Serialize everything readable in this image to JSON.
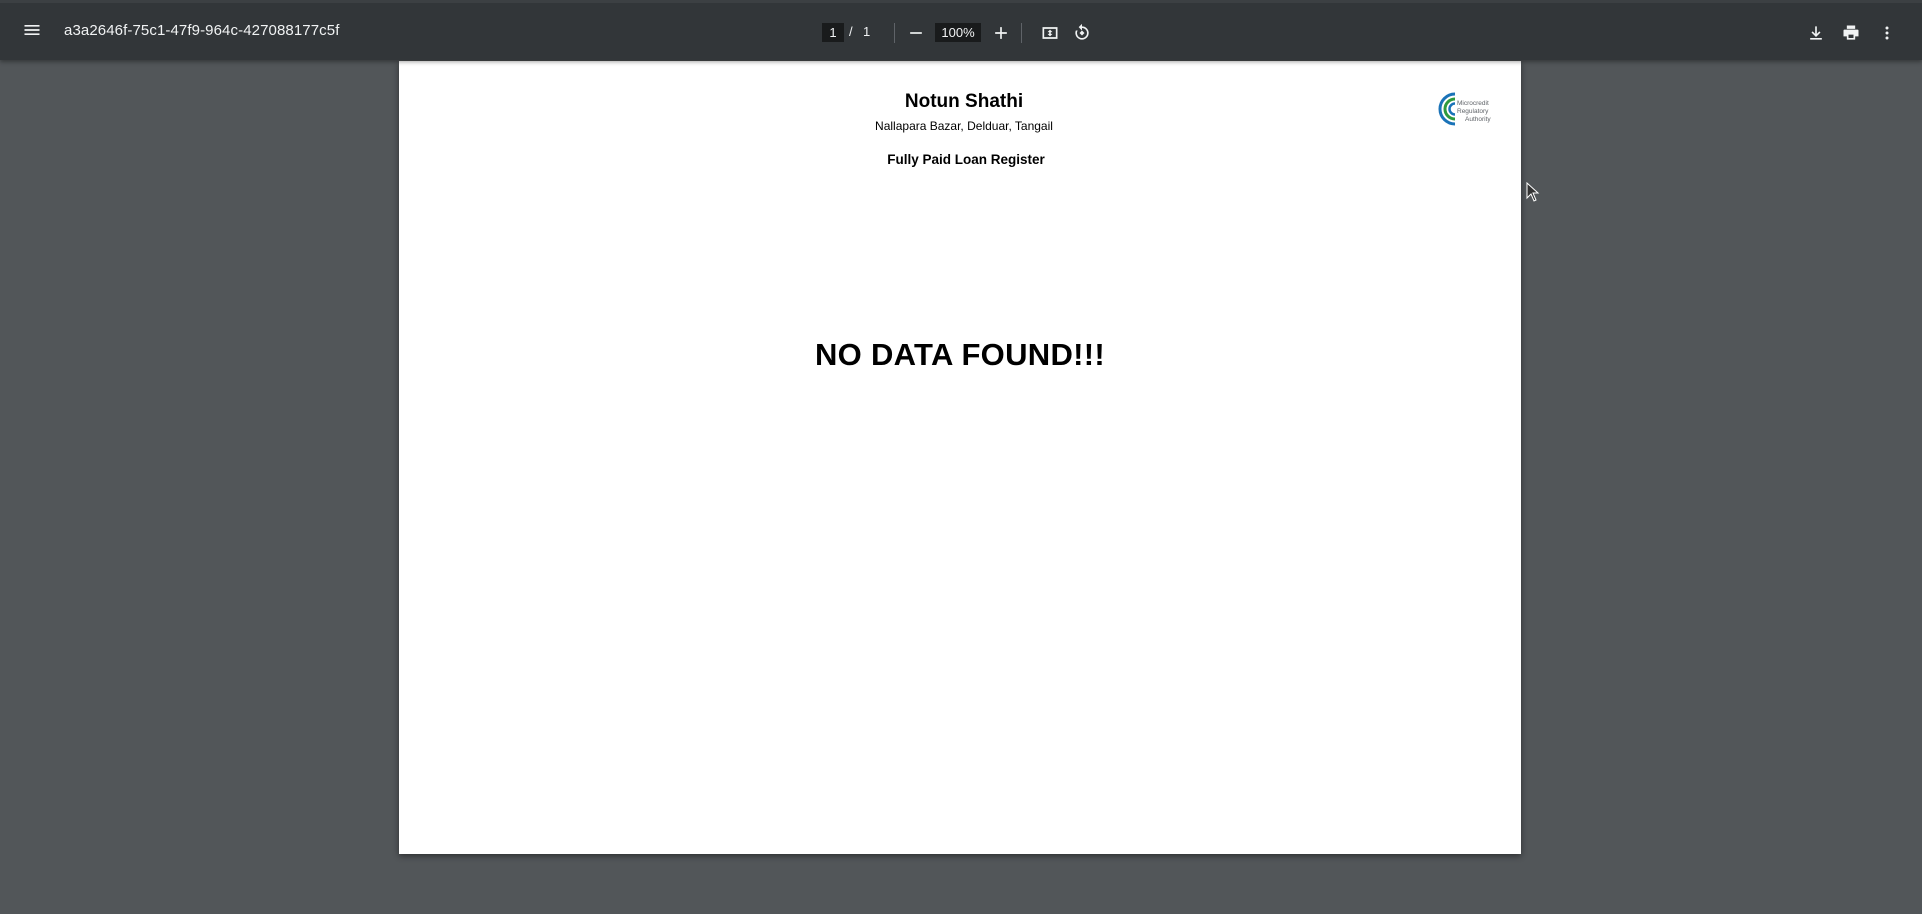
{
  "toolbar": {
    "doc_title": "a3a2646f-75c1-47f9-964c-427088177c5f",
    "page_current": "1",
    "page_separator": "/",
    "page_total": "1",
    "zoom": "100%"
  },
  "document": {
    "org_name": "Notun Shathi",
    "org_address": "Nallapara Bazar, Delduar, Tangail",
    "report_title": "Fully Paid Loan Register",
    "message": "NO DATA FOUND!!!",
    "logo": {
      "line1": "Microcredit",
      "line2": "Regulatory",
      "line3": "Authority",
      "colors": [
        "#1a73b8",
        "#2e9a3e"
      ]
    }
  },
  "icons": {
    "menu": "menu-icon",
    "zoom_out": "minus-icon",
    "zoom_in": "plus-icon",
    "fit": "fit-page-icon",
    "rotate": "rotate-icon",
    "download": "download-icon",
    "print": "print-icon",
    "more": "more-vert-icon"
  }
}
